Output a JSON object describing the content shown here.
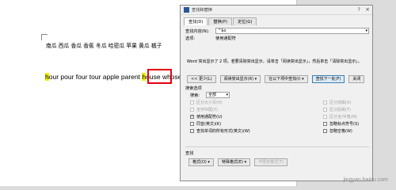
{
  "document": {
    "cn_line": "南瓜 西瓜 香瓜 香蕉 冬瓜 哈密瓜 苹果 黄瓜 橘子",
    "en_words": [
      {
        "text": "h",
        "highlight": true
      },
      {
        "text": "our pour four tour apple parent ",
        "highlight": false
      },
      {
        "text": "h",
        "highlight": true
      },
      {
        "text": "ouse ",
        "highlight": false
      },
      {
        "text": "whose",
        "highlight": false
      }
    ],
    "pilcrow": "↵"
  },
  "dialog": {
    "title": "查找和替换",
    "help": "?",
    "close": "×",
    "tabs": [
      "查找(D)",
      "替换(P)",
      "定位(G)"
    ],
    "find_label": "查找内容(N):",
    "find_value": "^$o",
    "options_label": "选项:",
    "options_value": "使用通配符",
    "info_text": "Word 突出显示了 2 项。若要清除突出显示，请单击「阅读突出显示」，然后单击「清除突出显示」。",
    "buttons": {
      "less": "<< 更少(L)",
      "reading_highlight": "阅读突出显示(R) ▾",
      "find_in": "在以下项中查找(I) ▾",
      "find_next": "查找下一处(F)",
      "close": "关闭"
    },
    "search_options_title": "搜索选项",
    "search_label": "搜索:",
    "search_value": "全部",
    "checkboxes_left": [
      {
        "label": "区分大小写(H)",
        "checked": false,
        "disabled": true
      },
      {
        "label": "全字匹配(Y)",
        "checked": false,
        "disabled": true
      },
      {
        "label": "使用通配符(U)",
        "checked": true,
        "disabled": false
      },
      {
        "label": "同音(英文)(K)",
        "checked": false,
        "disabled": false
      },
      {
        "label": "查找单词的所有形式(英文)(W)",
        "checked": false,
        "disabled": false
      }
    ],
    "checkboxes_right": [
      {
        "label": "区分前缀(X)",
        "checked": false,
        "disabled": true
      },
      {
        "label": "区分后缀(T)",
        "checked": false,
        "disabled": true
      },
      {
        "label": "区分全/半角(M)",
        "checked": false,
        "disabled": true
      },
      {
        "label": "忽略标点符号(S)",
        "checked": false,
        "disabled": false
      },
      {
        "label": "忽略空格(W)",
        "checked": false,
        "disabled": false
      }
    ],
    "find_section_title": "查找",
    "bottom_buttons": {
      "format": "格式(O) ▾",
      "special": "特殊格式(E) ▾",
      "no_format": "不限定格式(T)"
    }
  },
  "watermark": "jingyan.baidu.com",
  "colors": {
    "highlight": "#f4f000",
    "annotation_box": "#e60012",
    "accent": "#2b579a"
  }
}
